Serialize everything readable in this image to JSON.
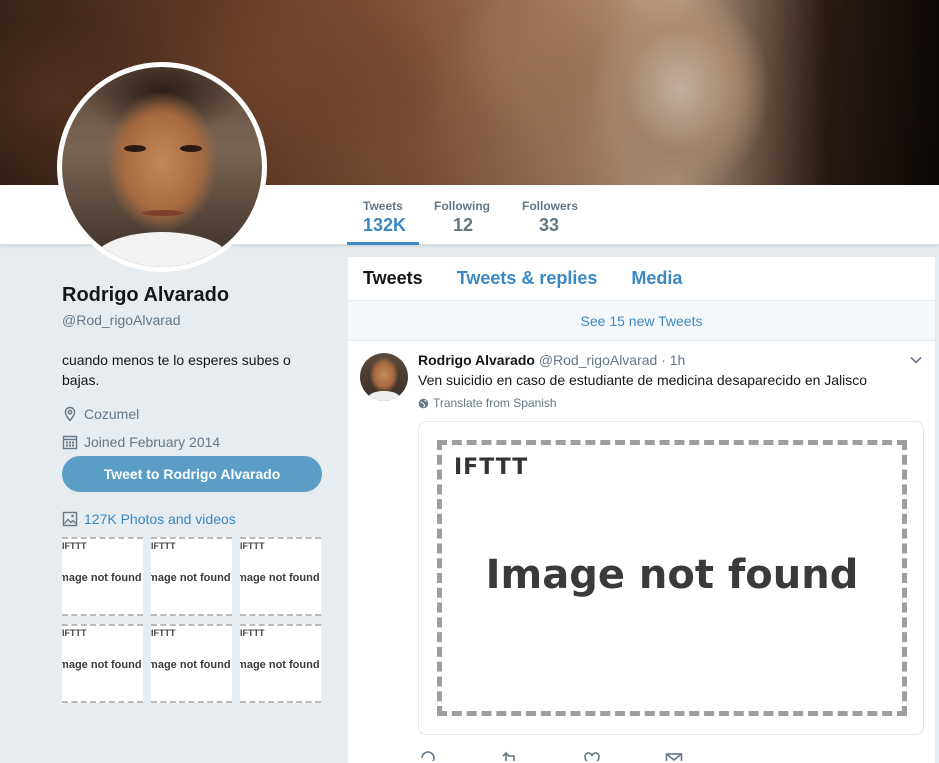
{
  "profile": {
    "name": "Rodrigo Alvarado",
    "handle": "@Rod_rigoAlvarad",
    "bio": "cuando menos te lo esperes subes o bajas.",
    "location": "Cozumel",
    "joined": "Joined February 2014",
    "tweet_to_label": "Tweet to Rodrigo Alvarado",
    "photos_label": "127K Photos and videos",
    "thumb_text": "Image not found",
    "thumb_brand": "IFTTT"
  },
  "stats": [
    {
      "label": "Tweets",
      "value": "132K"
    },
    {
      "label": "Following",
      "value": "12"
    },
    {
      "label": "Followers",
      "value": "33"
    }
  ],
  "timeline": {
    "tabs": [
      "Tweets",
      "Tweets & replies",
      "Media"
    ],
    "new_tweets": "See 15 new Tweets",
    "tweet": {
      "name": "Rodrigo Alvarado",
      "handle": "@Rod_rigoAlvarad",
      "time": "· 1h",
      "text": "Ven suicidio en caso de estudiante de medicina desaparecido en Jalisco",
      "translate": "Translate from Spanish",
      "media_brand": "IFTTT",
      "media_text": "Image not found"
    }
  },
  "icons": [
    "location-icon",
    "calendar-icon",
    "photo-icon",
    "globe-icon",
    "chevron-down-icon",
    "reply-icon",
    "retweet-icon",
    "like-icon",
    "message-icon"
  ],
  "colors": {
    "accent": "#3b88c3",
    "button": "#5a9ec7",
    "background": "#e6ecf0"
  }
}
